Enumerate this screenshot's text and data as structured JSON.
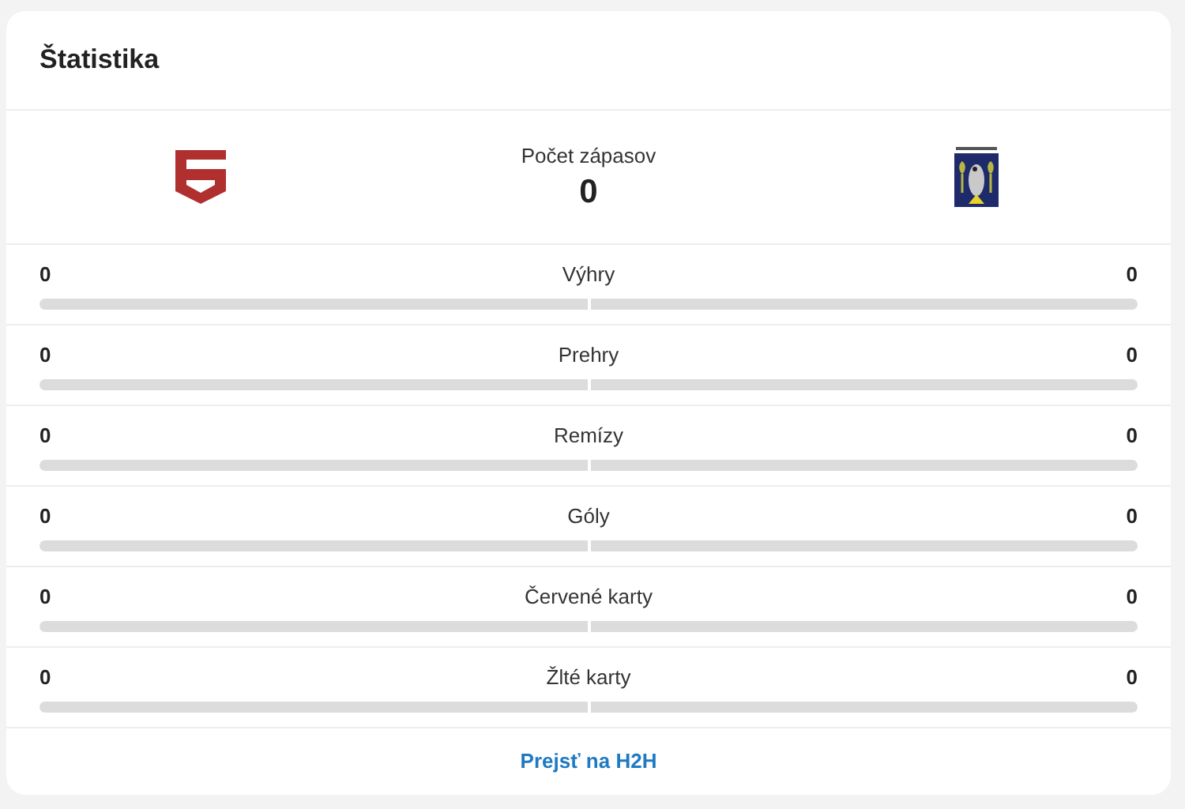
{
  "title": "Štatistika",
  "matches": {
    "label": "Počet zápasov",
    "value": "0"
  },
  "stats": [
    {
      "label": "Výhry",
      "home": {
        "value": "0",
        "level": 0
      },
      "away": {
        "value": "0",
        "level": 0
      }
    },
    {
      "label": "Prehry",
      "home": {
        "value": "0",
        "level": 0
      },
      "away": {
        "value": "0",
        "level": 0
      }
    },
    {
      "label": "Remízy",
      "home": {
        "value": "0",
        "level": 0
      },
      "away": {
        "value": "0",
        "level": 0
      }
    },
    {
      "label": "Góly",
      "home": {
        "value": "0",
        "level": 0
      },
      "away": {
        "value": "0",
        "level": 0
      }
    },
    {
      "label": "Červené karty",
      "home": {
        "value": "0",
        "level": 0
      },
      "away": {
        "value": "0",
        "level": 0
      }
    },
    {
      "label": "Žlté karty",
      "home": {
        "value": "0",
        "level": 0
      },
      "away": {
        "value": "0",
        "level": 0
      }
    }
  ],
  "link": "Prejsť na H2H"
}
